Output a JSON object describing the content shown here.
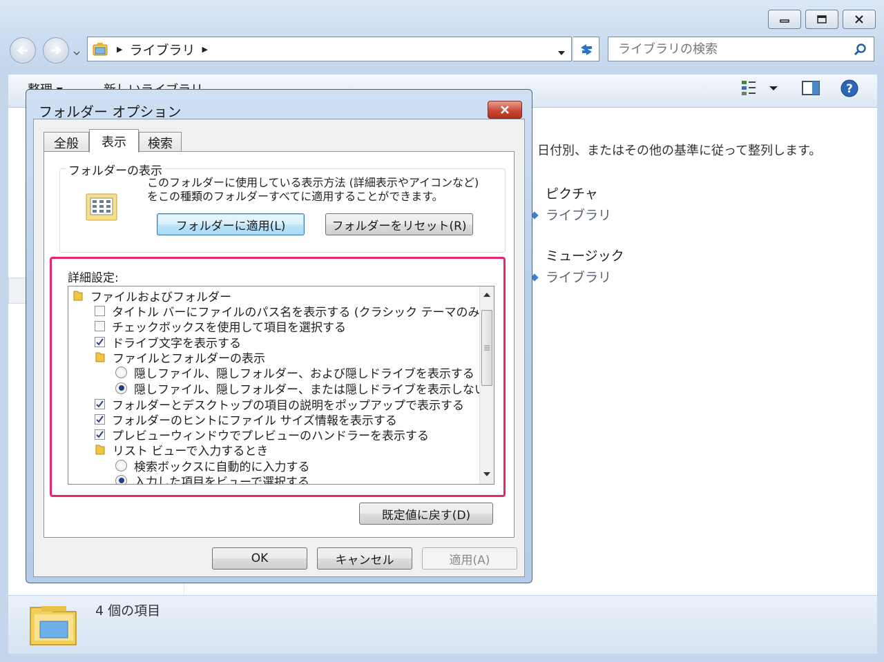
{
  "explorer": {
    "address": {
      "crumb": "ライブラリ"
    },
    "search": {
      "placeholder": "ライブラリの検索"
    },
    "toolbar": {
      "organize": "整理 ▾",
      "new_library": "新しいライブラリ"
    },
    "arrange_text": "日付別、またはその他の基準に従って整列します。",
    "libraries": [
      {
        "title": "ピクチャ",
        "subtitle": "ライブラリ"
      },
      {
        "title": "ミュージック",
        "subtitle": "ライブラリ"
      }
    ],
    "status": "4 個の項目"
  },
  "dialog": {
    "title": "フォルダー オプション",
    "tabs": [
      "全般",
      "表示",
      "検索"
    ],
    "active_tab": "表示",
    "folder_views": {
      "label": "フォルダーの表示",
      "description": "このフォルダーに使用している表示方法 (詳細表示やアイコンなど) をこの種類のフォルダーすべてに適用することができます。",
      "apply_button": "フォルダーに適用(L)",
      "reset_button": "フォルダーをリセット(R)"
    },
    "advanced": {
      "label": "詳細設定:",
      "items": [
        {
          "type": "folder",
          "text": "ファイルおよびフォルダー"
        },
        {
          "type": "checkbox",
          "text": "タイトル バーにファイルのパス名を表示する (クラシック テーマのみ)",
          "checked": false
        },
        {
          "type": "checkbox",
          "text": "チェックボックスを使用して項目を選択する",
          "checked": false
        },
        {
          "type": "checkbox",
          "text": "ドライブ文字を表示する",
          "checked": true
        },
        {
          "type": "folder",
          "text": "ファイルとフォルダーの表示"
        },
        {
          "type": "radio",
          "text": "隠しファイル、隠しフォルダー、および隠しドライブを表示する",
          "checked": false
        },
        {
          "type": "radio",
          "text": "隠しファイル、隠しフォルダー、または隠しドライブを表示しない",
          "checked": true
        },
        {
          "type": "checkbox",
          "text": "フォルダーとデスクトップの項目の説明をポップアップで表示する",
          "checked": true
        },
        {
          "type": "checkbox",
          "text": "フォルダーのヒントにファイル サイズ情報を表示する",
          "checked": true
        },
        {
          "type": "checkbox",
          "text": "プレビューウィンドウでプレビューのハンドラーを表示する",
          "checked": true
        },
        {
          "type": "folder",
          "text": "リスト ビューで入力するとき"
        },
        {
          "type": "radio",
          "text": "検索ボックスに自動的に入力する",
          "checked": false
        },
        {
          "type": "radio",
          "text": "入力した項目をビューで選択する",
          "checked": true
        }
      ]
    },
    "restore_defaults": "既定値に戻す(D)",
    "ok": "OK",
    "cancel": "キャンセル",
    "apply": "適用(A)"
  },
  "colors": {
    "highlight": "#e8236f",
    "accent": "#3a7fd0"
  }
}
